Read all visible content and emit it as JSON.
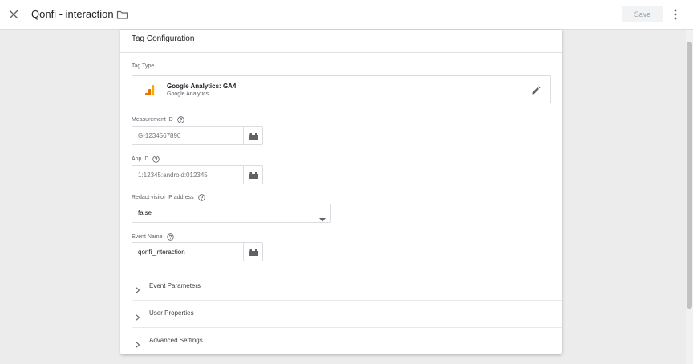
{
  "header": {
    "title": "Qonfi - interaction",
    "save_label": "Save"
  },
  "card": {
    "title": "Tag Configuration",
    "tag_type": {
      "label": "Tag Type",
      "name": "Google Analytics: GA4",
      "subtitle": "Google Analytics"
    },
    "measurement_id": {
      "label": "Measurement ID",
      "placeholder": "G-1234567890"
    },
    "app_id": {
      "label": "App ID",
      "placeholder": "1:12345:android:012345"
    },
    "redact_ip": {
      "label": "Redact visitor IP address",
      "value": "false"
    },
    "event_name": {
      "label": "Event Name",
      "value": "qonfi_interaction"
    },
    "sections": [
      {
        "label": "Event Parameters"
      },
      {
        "label": "User Properties"
      },
      {
        "label": "Advanced Settings"
      }
    ]
  },
  "colors": {
    "ga_orange": "#f9ab00",
    "ga_dark_orange": "#e37400"
  }
}
